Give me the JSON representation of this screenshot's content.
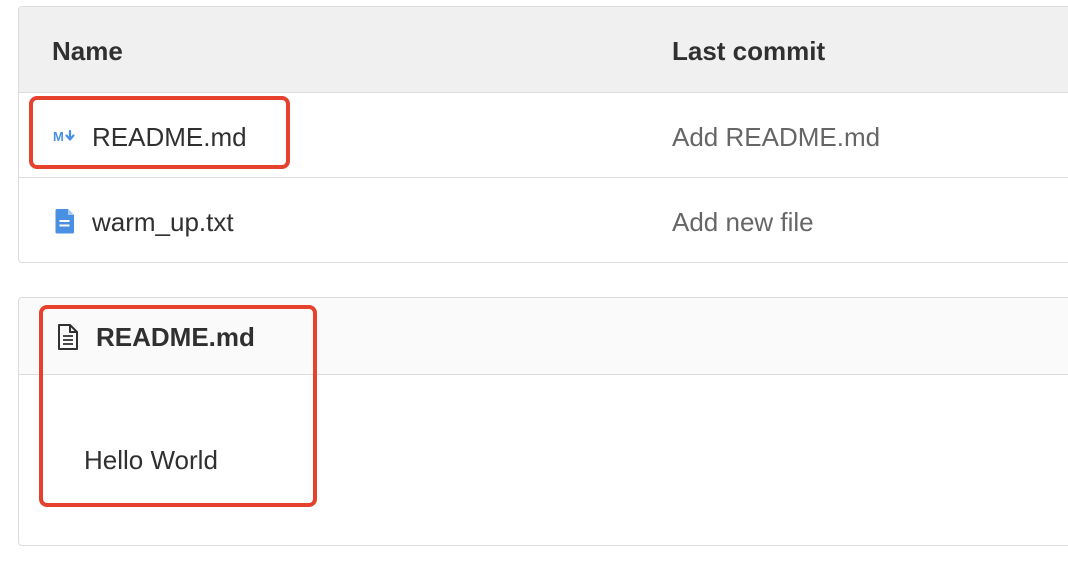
{
  "table": {
    "headers": {
      "name": "Name",
      "last_commit": "Last commit"
    },
    "rows": [
      {
        "name": "README.md",
        "icon": "markdown-icon",
        "commit": "Add README.md"
      },
      {
        "name": "warm_up.txt",
        "icon": "text-file-icon",
        "commit": "Add new file"
      }
    ]
  },
  "readme": {
    "title": "README.md",
    "icon": "document-icon",
    "content": "Hello World"
  },
  "colors": {
    "highlight": "#e5412d",
    "icon_blue": "#4a90e2",
    "header_bg": "#f0f0f0"
  }
}
